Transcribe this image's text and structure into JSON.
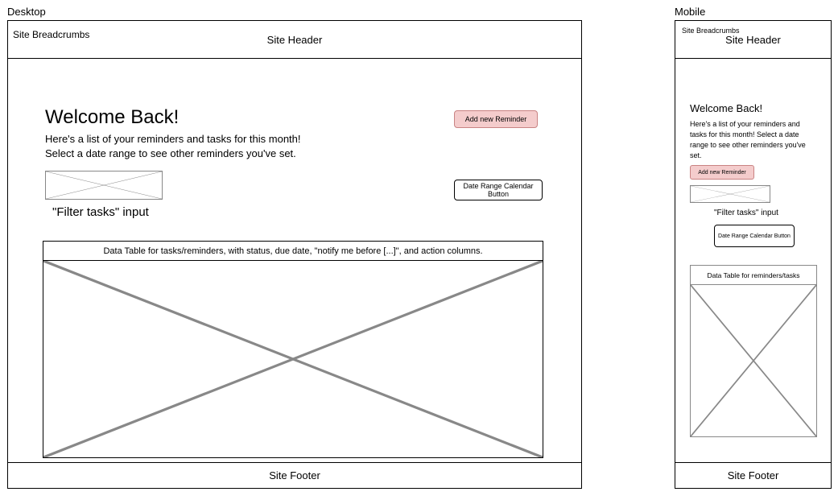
{
  "frames": {
    "desktop_label": "Desktop",
    "mobile_label": "Mobile"
  },
  "common": {
    "site_header": "Site Header",
    "site_breadcrumbs": "Site Breadcrumbs",
    "site_footer": "Site Footer",
    "welcome_title": "Welcome Back!",
    "add_reminder_button": "Add new Reminder",
    "date_range_button": "Date Range Calendar Button",
    "filter_input_caption": "\"Filter tasks\" input"
  },
  "desktop": {
    "welcome_subtitle_line1": "Here's a list of your reminders and tasks for this month!",
    "welcome_subtitle_line2": "Select a date range to see other reminders you've set.",
    "data_table_caption": "Data Table for tasks/reminders, with status, due date, \"notify me before [...]\", and action columns."
  },
  "mobile": {
    "welcome_subtitle": "Here's a list of your reminders and tasks for this month! Select a date range to see other reminders you've set.",
    "data_table_caption": "Data Table for reminders/tasks"
  }
}
